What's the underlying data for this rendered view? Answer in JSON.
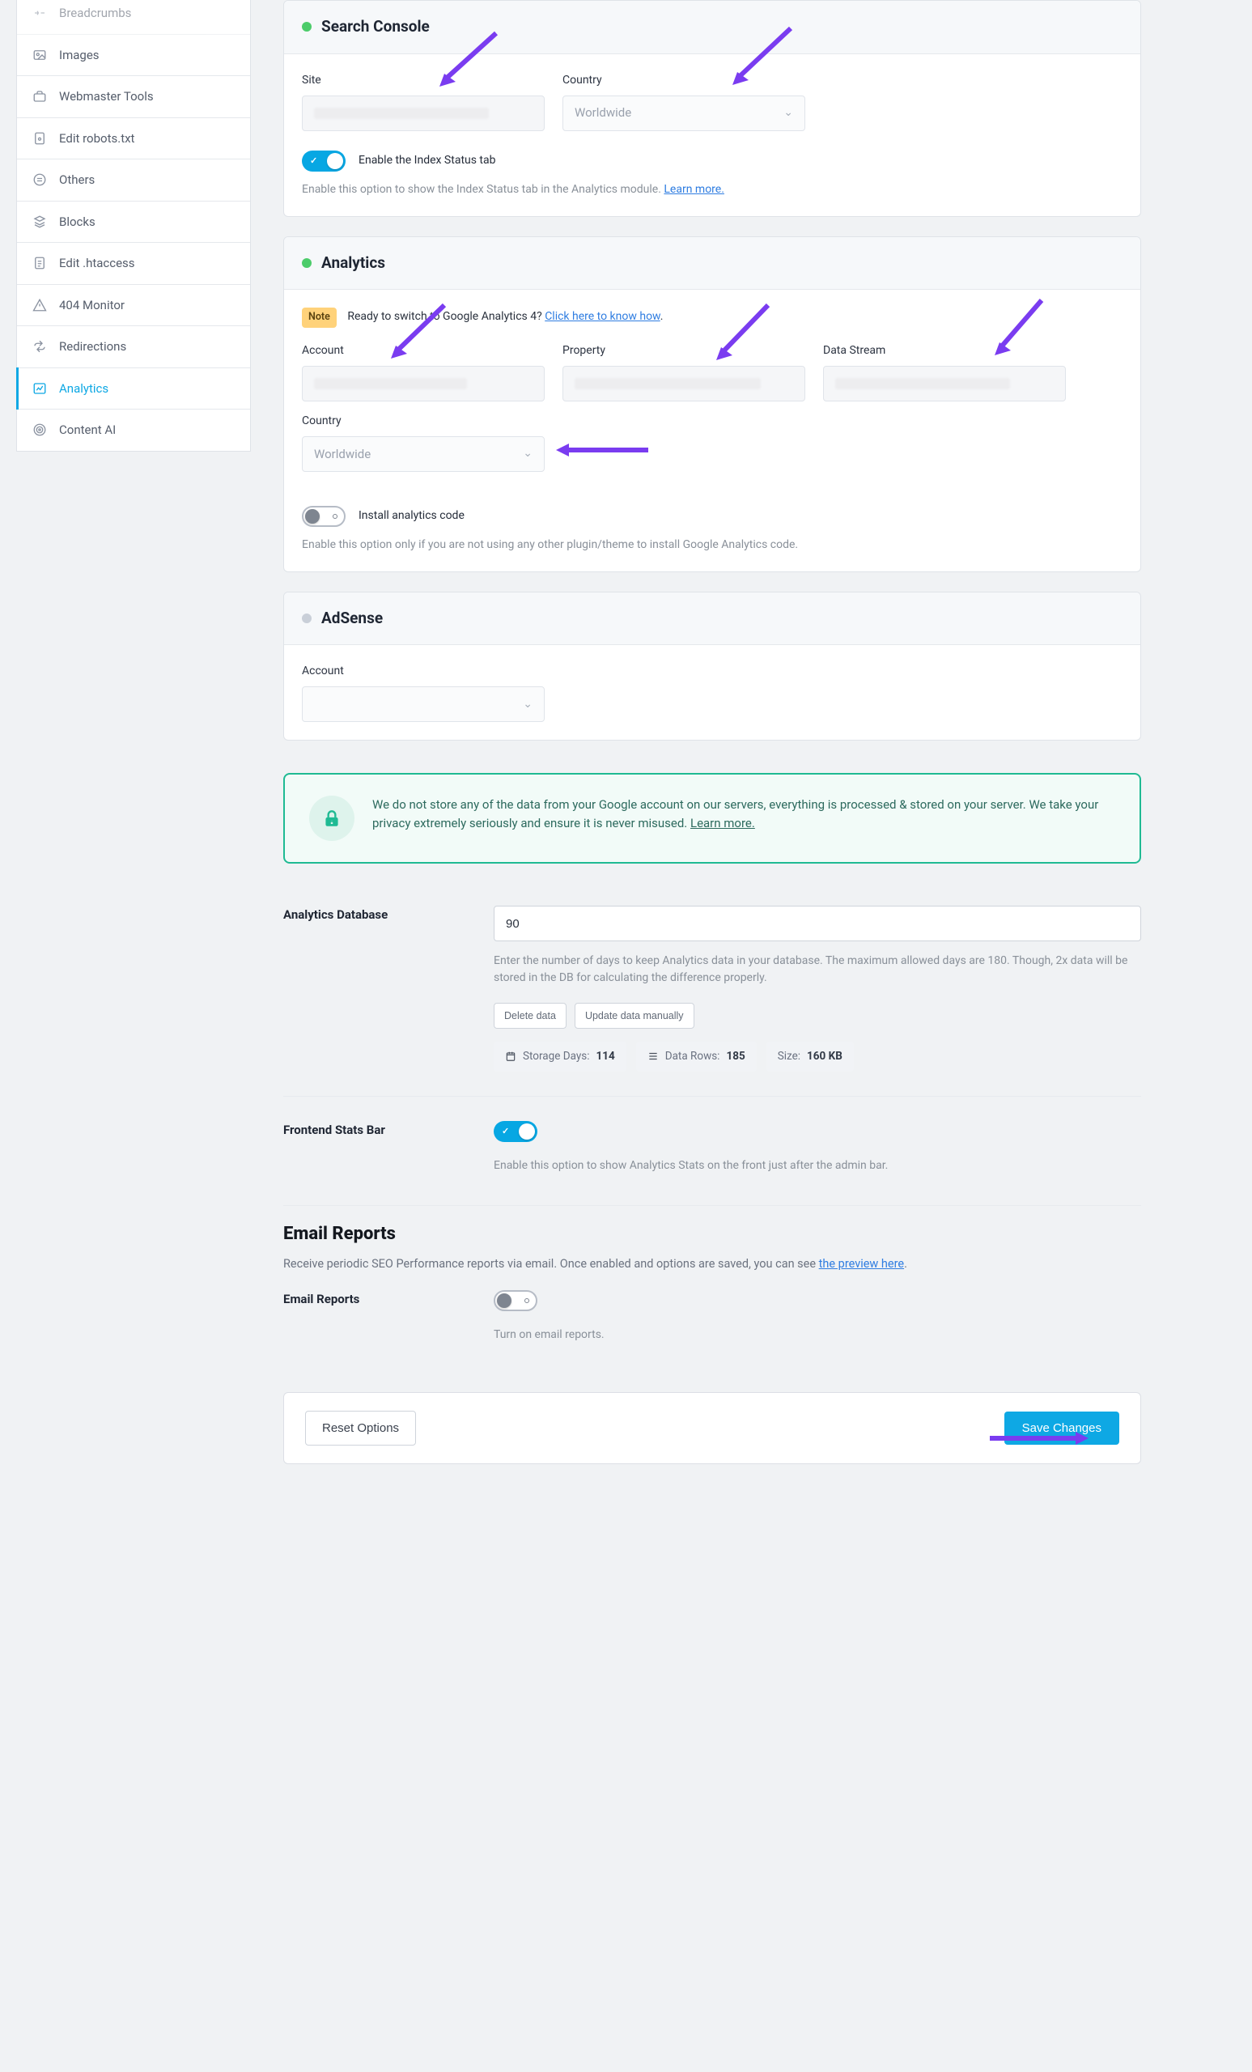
{
  "sidebar": {
    "items": [
      {
        "label": "Breadcrumbs"
      },
      {
        "label": "Images"
      },
      {
        "label": "Webmaster Tools"
      },
      {
        "label": "Edit robots.txt"
      },
      {
        "label": "Others"
      },
      {
        "label": "Blocks"
      },
      {
        "label": "Edit .htaccess"
      },
      {
        "label": "404 Monitor"
      },
      {
        "label": "Redirections"
      },
      {
        "label": "Analytics"
      },
      {
        "label": "Content AI"
      }
    ]
  },
  "searchConsole": {
    "title": "Search Console",
    "siteLabel": "Site",
    "countryLabel": "Country",
    "countryValue": "Worldwide",
    "indexToggleLabel": "Enable the Index Status tab",
    "indexHelp": "Enable this option to show the Index Status tab in the Analytics module.",
    "learnMore": "Learn more."
  },
  "analytics": {
    "title": "Analytics",
    "noteBadge": "Note",
    "noteText": "Ready to switch to Google Analytics 4?",
    "noteLink": "Click here to know how",
    "accountLabel": "Account",
    "propertyLabel": "Property",
    "dataStreamLabel": "Data Stream",
    "countryLabel": "Country",
    "countryValue": "Worldwide",
    "installLabel": "Install analytics code",
    "installHelp": "Enable this option only if you are not using any other plugin/theme to install Google Analytics code."
  },
  "adsense": {
    "title": "AdSense",
    "accountLabel": "Account"
  },
  "privacy": {
    "text": "We do not store any of the data from your Google account on our servers, everything is processed & stored on your server. We take your privacy extremely seriously and ensure it is never misused.",
    "learnMore": "Learn more."
  },
  "db": {
    "label": "Analytics Database",
    "value": "90",
    "help": "Enter the number of days to keep Analytics data in your database. The maximum allowed days are 180. Though, 2x data will be stored in the DB for calculating the difference properly.",
    "deleteBtn": "Delete data",
    "updateBtn": "Update data manually",
    "storageDaysLabel": "Storage Days:",
    "storageDaysValue": "114",
    "dataRowsLabel": "Data Rows:",
    "dataRowsValue": "185",
    "sizeLabel": "Size:",
    "sizeValue": "160 KB"
  },
  "frontend": {
    "label": "Frontend Stats Bar",
    "help": "Enable this option to show Analytics Stats on the front just after the admin bar."
  },
  "emailReports": {
    "heading": "Email Reports",
    "intro": "Receive periodic SEO Performance reports via email. Once enabled and options are saved, you can see",
    "introLink": "the preview here",
    "toggleLabel": "Email Reports",
    "toggleHelp": "Turn on email reports."
  },
  "footer": {
    "reset": "Reset Options",
    "save": "Save Changes"
  }
}
